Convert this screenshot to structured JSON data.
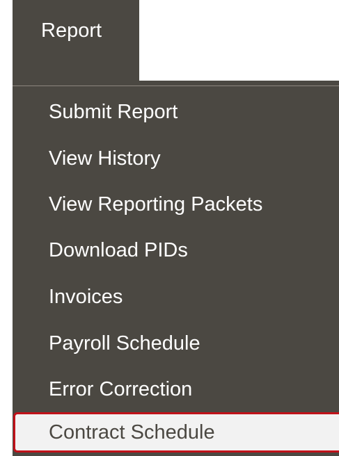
{
  "menu": {
    "top_label": "Report",
    "items": [
      {
        "label": "Submit Report"
      },
      {
        "label": "View History"
      },
      {
        "label": "View Reporting Packets"
      },
      {
        "label": "Download PIDs"
      },
      {
        "label": "Invoices"
      },
      {
        "label": "Payroll Schedule"
      },
      {
        "label": "Error Correction"
      },
      {
        "label": "Contract Schedule",
        "active": true
      }
    ]
  },
  "colors": {
    "menu_background": "#4b4842",
    "menu_text": "#ffffff",
    "active_background": "#f2f2f2",
    "active_border": "#c0121a"
  }
}
